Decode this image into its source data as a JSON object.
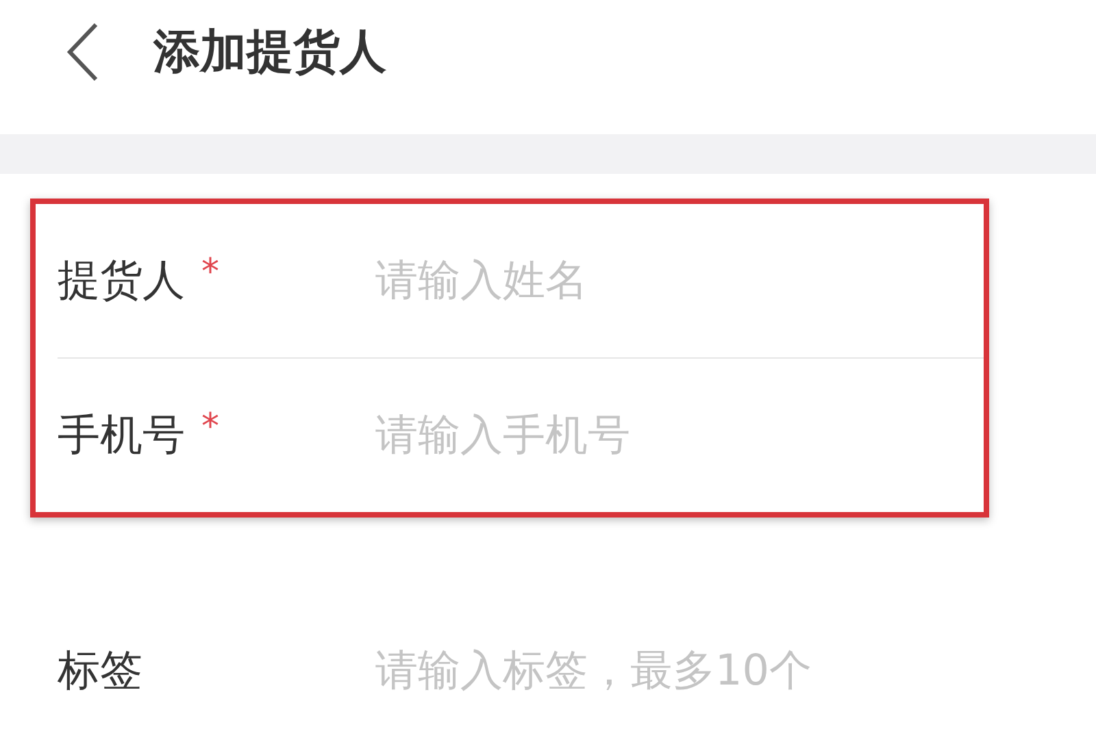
{
  "header": {
    "title": "添加提货人"
  },
  "sections": [
    {
      "highlighted": true,
      "fields": [
        {
          "label": "提货人",
          "required_mark": "*",
          "placeholder": "请输入姓名"
        },
        {
          "label": "手机号",
          "required_mark": "*",
          "placeholder": "请输入手机号"
        }
      ]
    },
    {
      "highlighted": false,
      "fields": [
        {
          "label": "标签",
          "placeholder": "请输入标签，最多10个"
        }
      ]
    }
  ]
}
